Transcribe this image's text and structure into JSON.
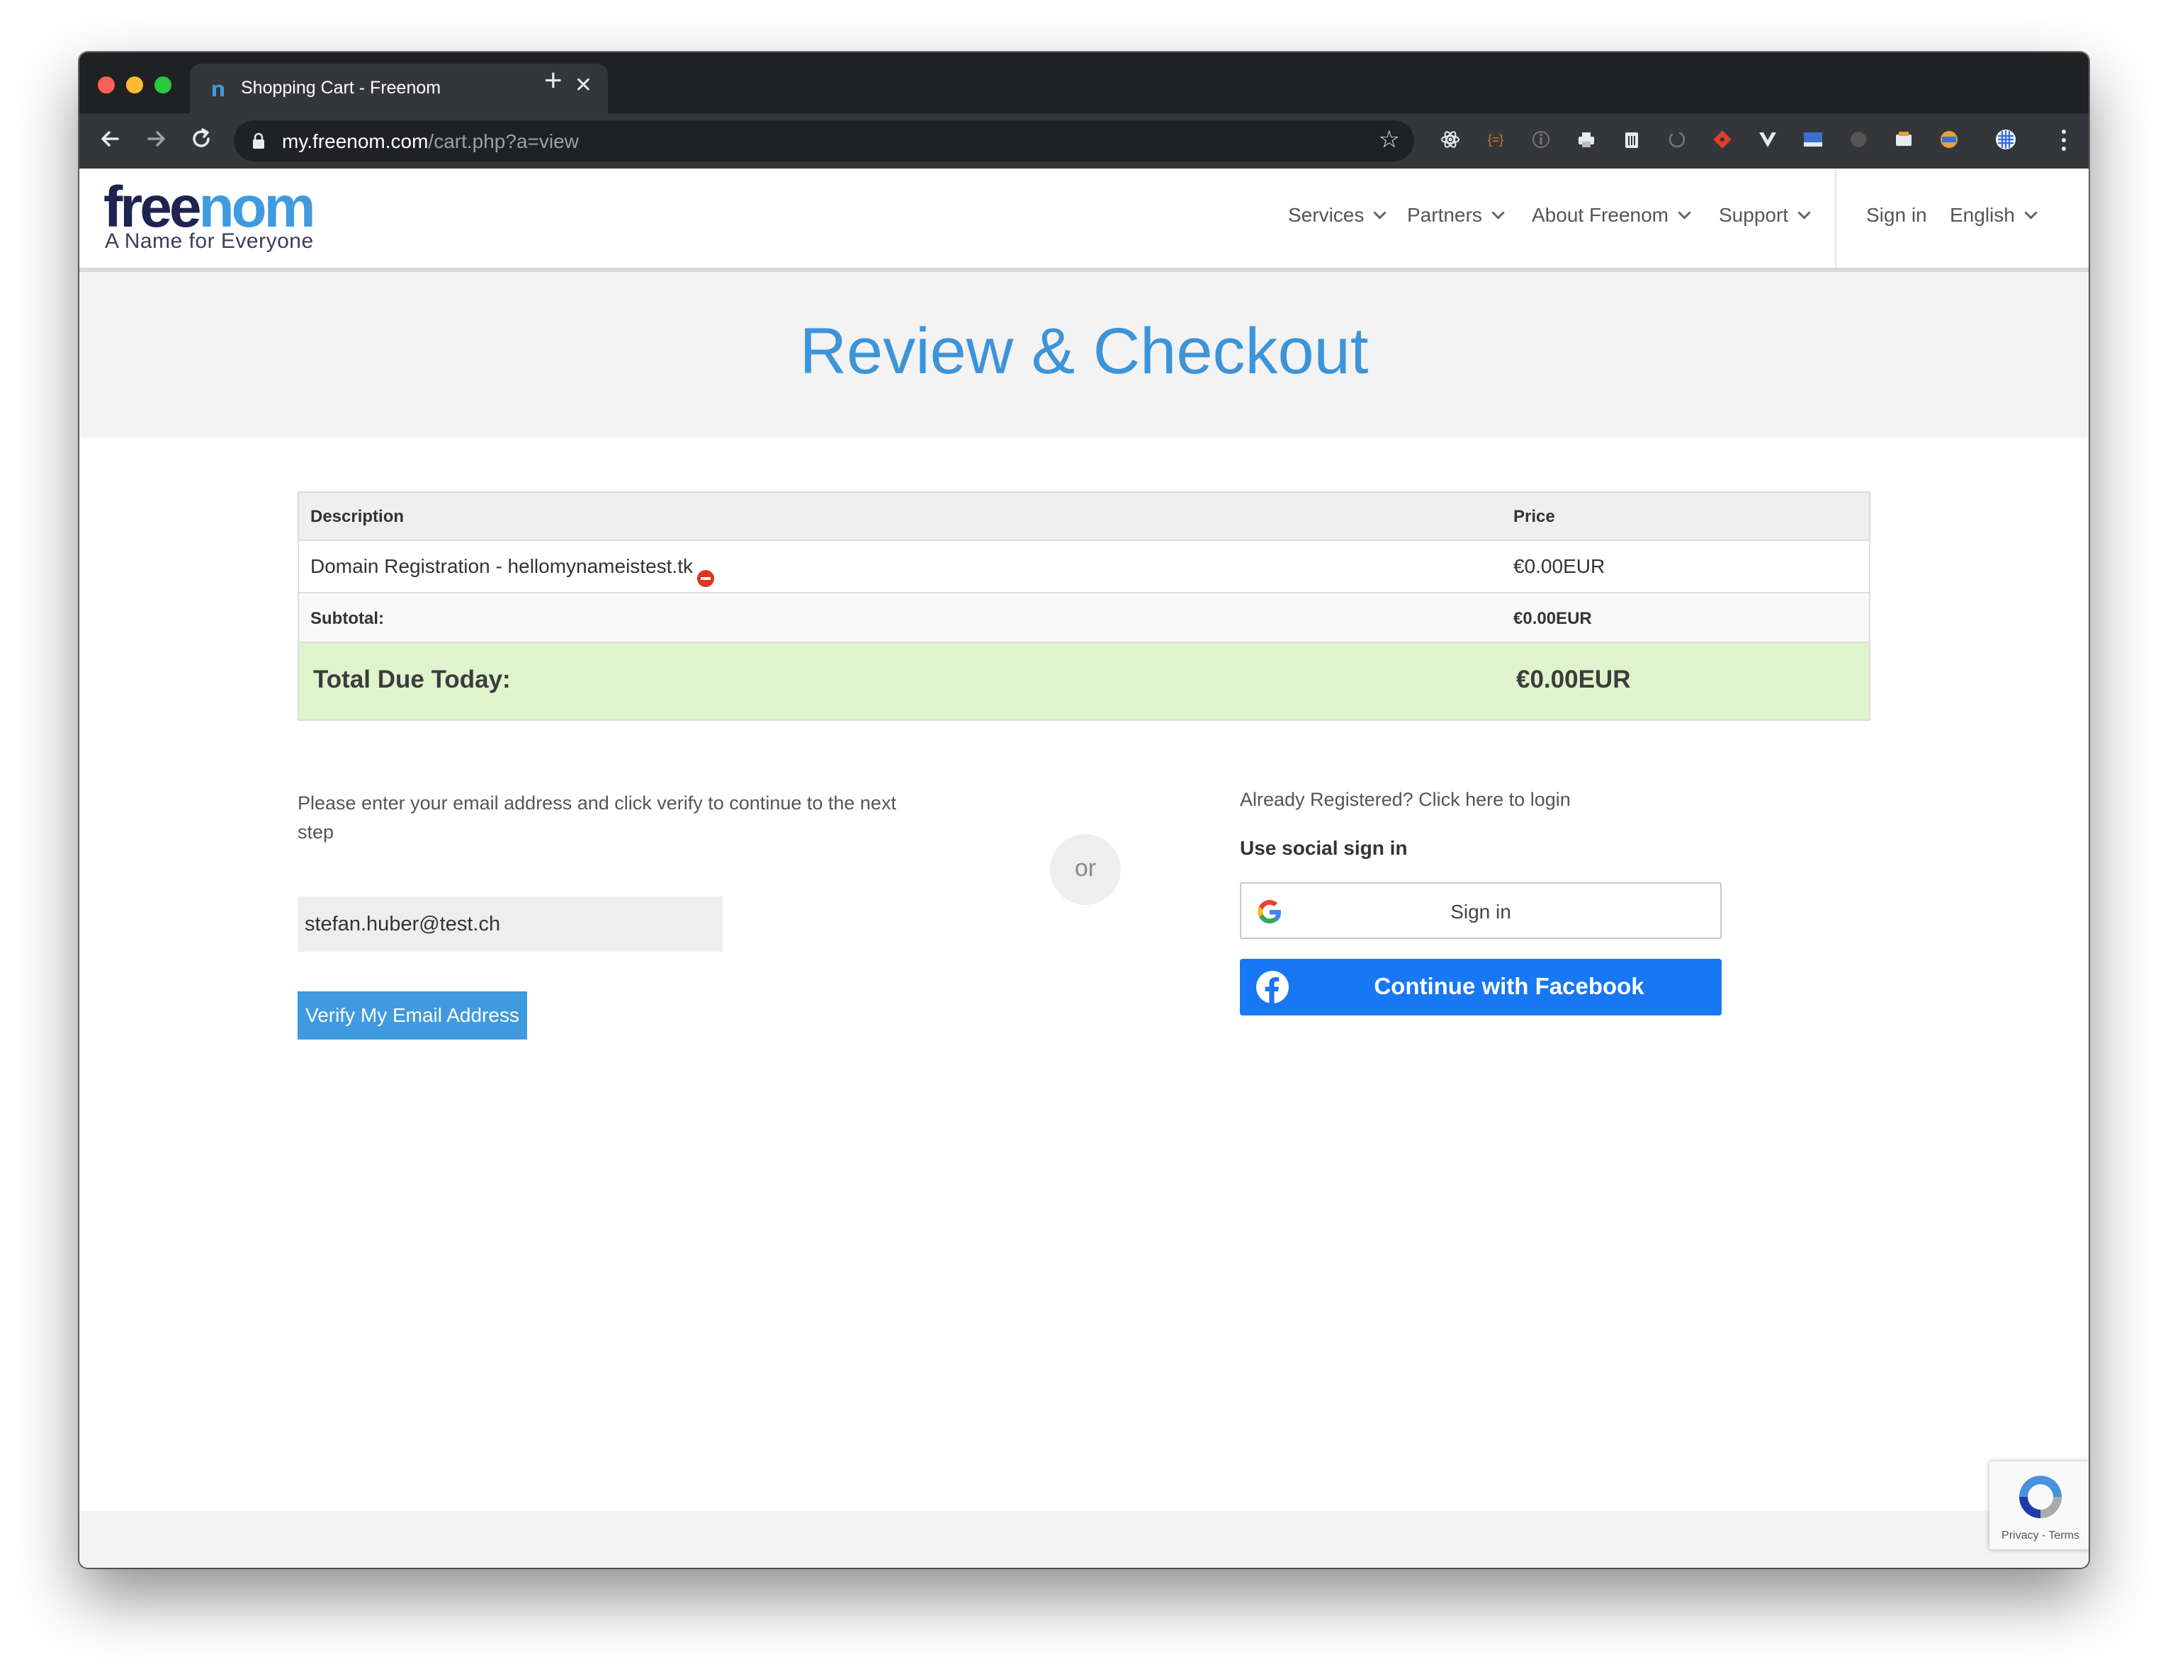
{
  "browser": {
    "tab_title": "Shopping Cart - Freenom",
    "url_host": "my.freenom.com",
    "url_path": "/cart.php?a=view"
  },
  "header": {
    "logo_part1": "free",
    "logo_part2": "nom",
    "tagline": "A Name for Everyone",
    "nav": {
      "services": "Services",
      "partners": "Partners",
      "about": "About Freenom",
      "support": "Support",
      "sign_in": "Sign in",
      "language": "English"
    }
  },
  "hero": {
    "title": "Review & Checkout"
  },
  "cart": {
    "headers": {
      "description": "Description",
      "price": "Price"
    },
    "item": {
      "description": "Domain Registration - hellomynameistest.tk",
      "price": "€0.00EUR"
    },
    "subtotal": {
      "label": "Subtotal:",
      "value": "€0.00EUR"
    },
    "total": {
      "label": "Total Due Today:",
      "value": "€0.00EUR"
    }
  },
  "email_section": {
    "instructions": "Please enter your email address and click verify to continue to the next step",
    "email_value": "stefan.huber@test.ch",
    "verify_label": "Verify My Email Address"
  },
  "divider": {
    "or": "or"
  },
  "login_section": {
    "already_registered": "Already Registered? Click here to login",
    "social_label": "Use social sign in",
    "google_label": "Sign in",
    "facebook_label": "Continue with Facebook"
  },
  "recaptcha": {
    "terms": "Privacy - Terms"
  },
  "colors": {
    "accent": "#3f9ae0",
    "logo_dark": "#1e2350",
    "total_bg": "#dff3cd",
    "facebook": "#1877f2"
  }
}
